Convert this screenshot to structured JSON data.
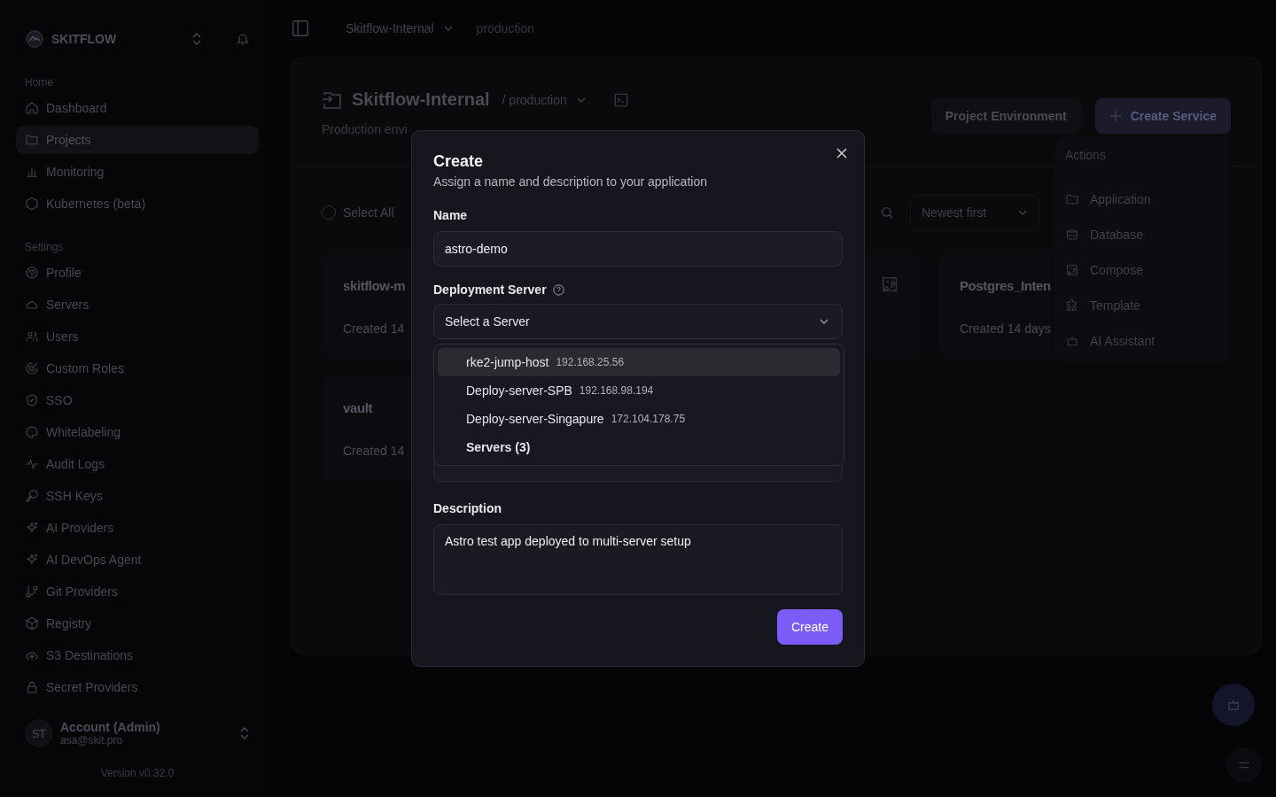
{
  "sidebar": {
    "brand": "SKITFLOW",
    "sections": [
      {
        "heading": "Home",
        "items": [
          {
            "label": "Dashboard",
            "selected": false
          },
          {
            "label": "Projects",
            "selected": true
          },
          {
            "label": "Monitoring",
            "selected": false
          },
          {
            "label": "Kubernetes (beta)",
            "selected": false
          }
        ]
      },
      {
        "heading": "Settings",
        "items": [
          {
            "label": "Profile",
            "selected": false
          },
          {
            "label": "Servers",
            "selected": false
          },
          {
            "label": "Users",
            "selected": false
          },
          {
            "label": "Custom Roles",
            "selected": false
          },
          {
            "label": "SSO",
            "selected": false
          },
          {
            "label": "Whitelabeling",
            "selected": false
          },
          {
            "label": "Audit Logs",
            "selected": false
          },
          {
            "label": "SSH Keys",
            "selected": false
          },
          {
            "label": "AI Providers",
            "selected": false
          },
          {
            "label": "AI DevOps Agent",
            "selected": false
          },
          {
            "label": "Git Providers",
            "selected": false
          },
          {
            "label": "Registry",
            "selected": false
          },
          {
            "label": "S3 Destinations",
            "selected": false
          },
          {
            "label": "Secret Providers",
            "selected": false
          }
        ]
      }
    ],
    "account": {
      "initials": "ST",
      "name": "Account (Admin)",
      "email": "asa@skit.pro"
    },
    "version": "Version v0.32.0"
  },
  "topbar": {
    "project": "Skitflow-Internal",
    "environment": "production"
  },
  "project": {
    "title": "Skitflow-Internal",
    "environment": "/ production",
    "description": "Production envi",
    "buttons": [
      "Project Environment",
      "Create Service"
    ],
    "select_all": "Select All",
    "select_all_checked": false,
    "sort": "Newest first",
    "cards": [
      {
        "title": "skitflow-m",
        "meta": "Created 14"
      },
      {
        "kind": "covered"
      },
      {
        "title": "Postgres_Inten",
        "meta": "Created 14 days"
      },
      {
        "title": "vault",
        "meta": "Created 14"
      }
    ]
  },
  "actions_menu": {
    "heading": "Actions",
    "items": [
      "Application",
      "Database",
      "Compose",
      "Template",
      "AI Assistant"
    ]
  },
  "dialog": {
    "title": "Create",
    "subtitle": "Assign a name and description to your application",
    "name_label": "Name",
    "name_value": "astro-demo",
    "server_label": "Deployment Server",
    "server_placeholder": "Select a Server",
    "server_options": [
      {
        "kind": "option",
        "name": "rke2-jump-host",
        "ip": "192.168.25.56",
        "highlighted": true
      },
      {
        "kind": "option",
        "name": "Deploy-server-SPB",
        "ip": "192.168.98.194",
        "highlighted": false
      },
      {
        "kind": "option",
        "name": "Deploy-server-Singapure",
        "ip": "172.104.178.75",
        "highlighted": false
      },
      {
        "kind": "group",
        "name": "Servers (3)",
        "highlighted": false
      }
    ],
    "description_label": "Description",
    "description_value": "Astro test app deployed to multi-server setup",
    "submit": "Create"
  }
}
